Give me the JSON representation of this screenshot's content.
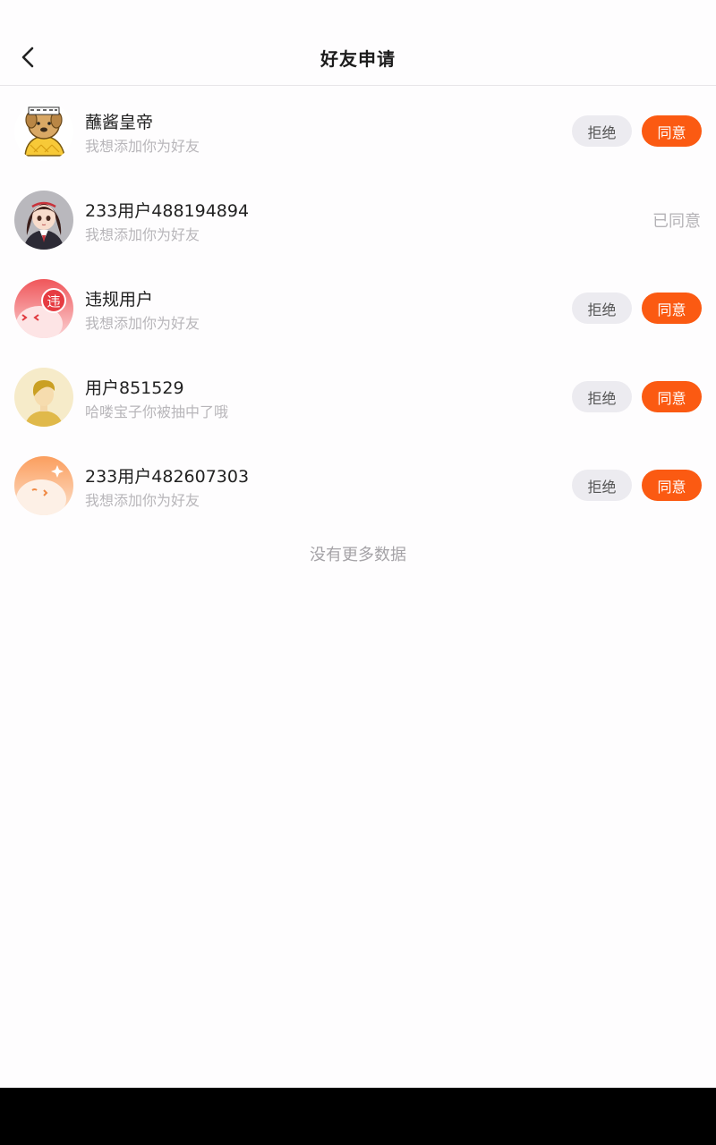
{
  "header": {
    "title": "好友申请",
    "back_icon": "chevron-left-icon"
  },
  "requests": [
    {
      "name": "蘸酱皇帝",
      "message": "我想添加你为好友",
      "avatar": "dog-emperor-avatar",
      "reject_label": "拒绝",
      "accept_label": "同意"
    },
    {
      "name": "233用户488194894",
      "message": "我想添加你为好友",
      "avatar": "anime-girl-avatar",
      "status": "已同意"
    },
    {
      "name": "违规用户",
      "message": "我想添加你为好友",
      "avatar": "violation-badge-avatar",
      "badge": "违",
      "reject_label": "拒绝",
      "accept_label": "同意"
    },
    {
      "name": "用户851529",
      "message": "哈喽宝子你被抽中了哦",
      "avatar": "default-person-avatar",
      "reject_label": "拒绝",
      "accept_label": "同意"
    },
    {
      "name": "233用户482607303",
      "message": "我想添加你为好友",
      "avatar": "orange-blob-avatar",
      "reject_label": "拒绝",
      "accept_label": "同意"
    }
  ],
  "footer": {
    "no_more_text": "没有更多数据"
  },
  "colors": {
    "accent": "#fb5a12",
    "reject_bg": "#ecebf0",
    "secondary_text": "#b8b6ba"
  }
}
